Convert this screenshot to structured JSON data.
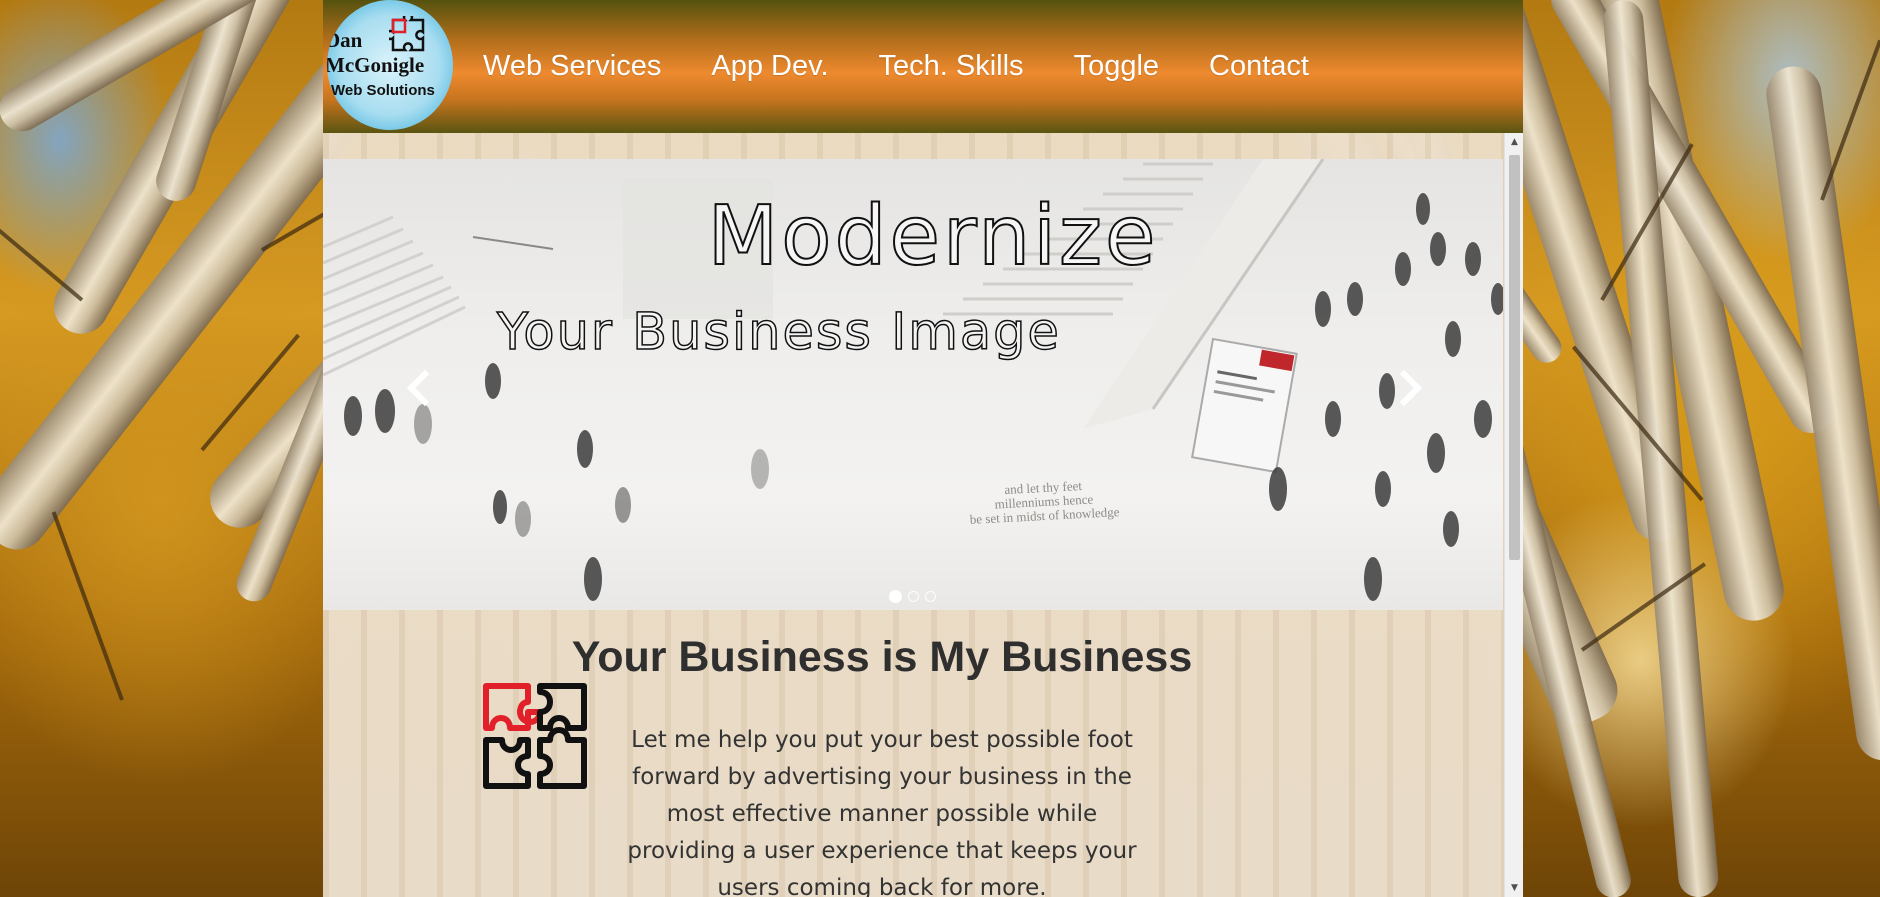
{
  "logo": {
    "line1": "Dan",
    "line2": "McGonigle",
    "line3": "Web Solutions"
  },
  "nav": {
    "items": [
      {
        "label": "Web Services"
      },
      {
        "label": "App Dev."
      },
      {
        "label": "Tech. Skills"
      },
      {
        "label": "Toggle"
      },
      {
        "label": "Contact"
      }
    ]
  },
  "carousel": {
    "title": "Modernize",
    "subtitle": "Your Business Image",
    "wall_text": [
      "and let thy feet",
      "millenniums hence",
      "be set in midst of knowledge"
    ],
    "slide_count": 3,
    "active_slide": 1,
    "prev_icon": "chevron-left-icon",
    "next_icon": "chevron-right-icon"
  },
  "intro": {
    "heading": "Your Business is My Business",
    "text": "Let me help you put your best possible foot forward by advertising your business in the most effective manner possible while providing a user experience that keeps your users coming back for more.",
    "icon": "puzzle-icon"
  },
  "colors": {
    "navbar_orange": "#ee8a2f",
    "navbar_olive": "#55520e",
    "puzzle_red": "#e2202a",
    "heading_text": "#2f2f2f"
  }
}
